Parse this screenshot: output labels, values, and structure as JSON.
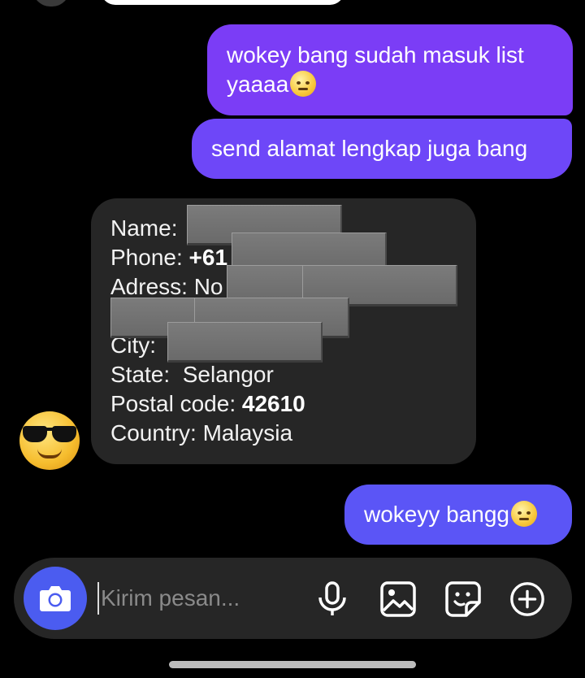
{
  "messages": {
    "outgoing_1": "wokey bang sudah masuk list yaaaa",
    "outgoing_2": "send alamat lengkap juga bang",
    "incoming": {
      "name_label": "Name:",
      "phone_label": "Phone:",
      "phone_value": "+61",
      "address_label": "Adress: No",
      "city_label": "City:",
      "state_label": "State:",
      "state_value": "Selangor",
      "postal_label": "Postal code:",
      "postal_value": "42610",
      "country_label": "Country:",
      "country_value": "Malaysia"
    },
    "outgoing_3": "wokeyy bangg"
  },
  "composer": {
    "placeholder": "Kirim pesan..."
  },
  "icons": {
    "emoji": "saluting-face-emoji-icon",
    "avatar": "sunglasses-face-avatar",
    "camera": "camera-icon",
    "mic": "microphone-icon",
    "gallery": "image-icon",
    "sticker": "sticker-icon",
    "more": "plus-circle-icon"
  },
  "colors": {
    "outgoing_bubble": "#7b3df6",
    "incoming_bubble": "#262626",
    "accent": "#4b5cf0",
    "background": "#000000"
  }
}
